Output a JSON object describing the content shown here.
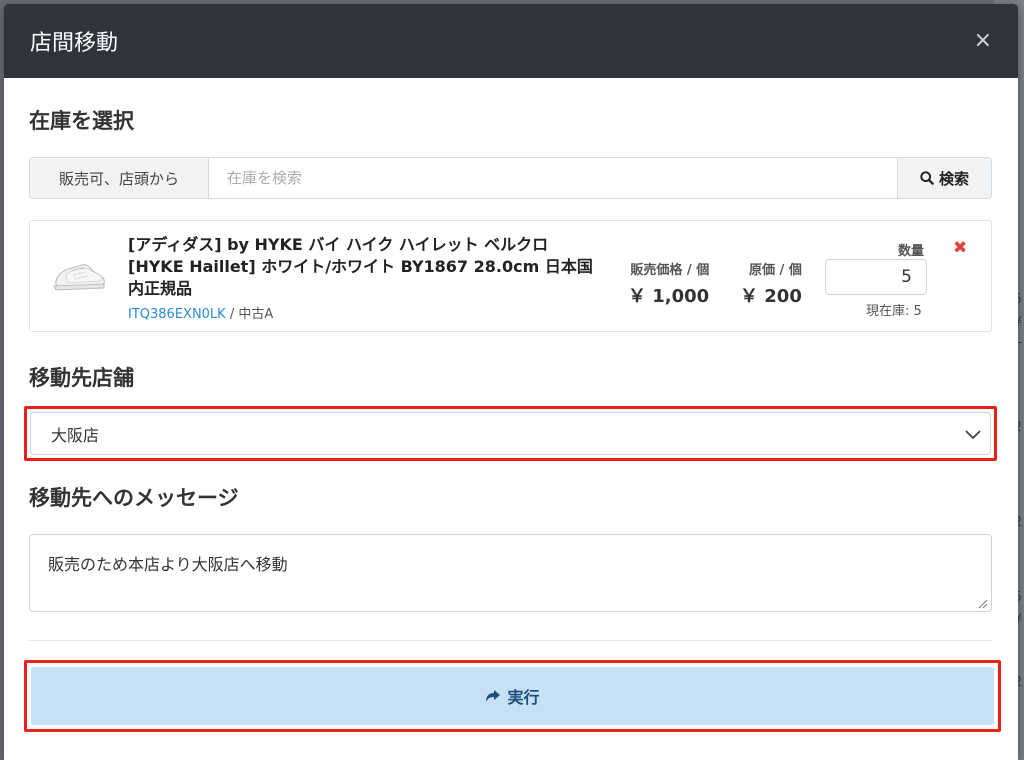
{
  "modal": {
    "title": "店間移動",
    "close_label": "×"
  },
  "stock_section": {
    "heading": "在庫を選択",
    "search": {
      "prefix_label": "販売可、店頭から",
      "placeholder": "在庫を検索",
      "button_label": "検索"
    }
  },
  "product": {
    "name": "[アディダス] by HYKE バイ ハイク ハイレット ベルクロ [HYKE Haillet] ホワイト/ホワイト BY1867 28.0cm 日本国内正規品",
    "sku": "ITQ386EXN0LK",
    "condition": " / 中古A",
    "sale_price_label": "販売価格 / 個",
    "sale_price": "￥ 1,000",
    "cost_price_label": "原価 / 個",
    "cost_price": "￥ 200",
    "quantity_label": "数量",
    "quantity": "5",
    "stock_note": "現在庫: 5",
    "remove_label": "✖",
    "thumbnail_icon": "sneaker-image"
  },
  "destination_section": {
    "heading": "移動先店舗",
    "selected_store": "大阪店"
  },
  "message_section": {
    "heading": "移動先へのメッセージ",
    "message": "販売のため本店より大阪店へ移動"
  },
  "actions": {
    "execute_label": "実行"
  },
  "colors": {
    "header_bg": "#2f3438",
    "execute_bg": "#c6e0f5",
    "highlight": "#e8211b",
    "link": "#2b8ad6",
    "remove": "#e0453c"
  }
}
